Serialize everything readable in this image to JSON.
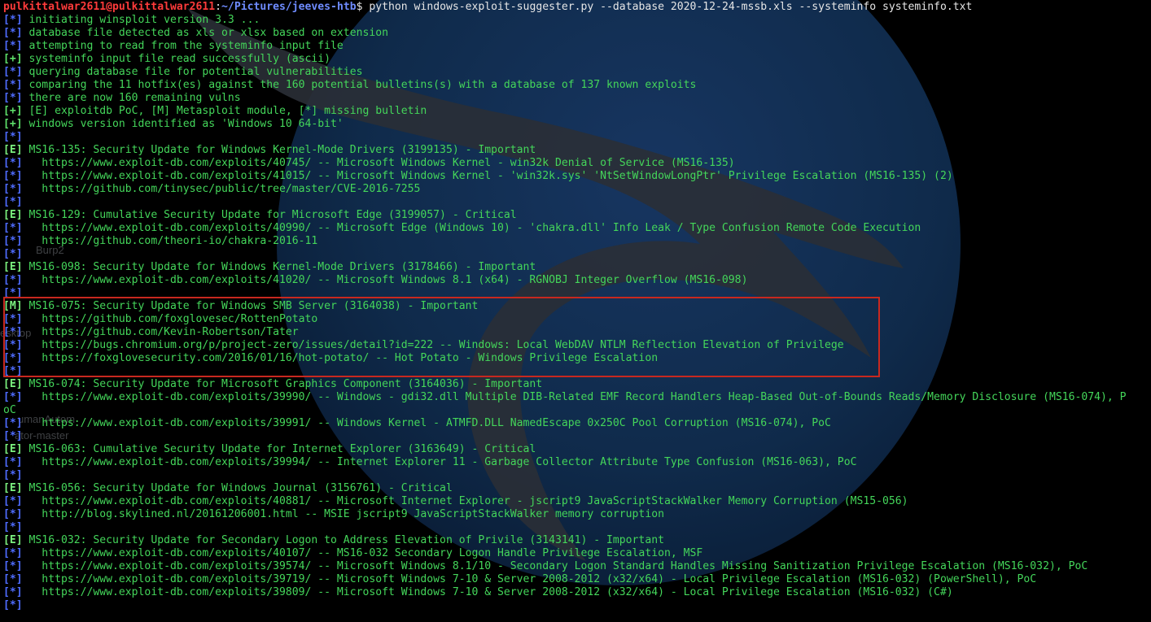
{
  "prompt": {
    "user_host": "pulkittalwar2611@pulkittalwar2611",
    "sep": ":",
    "path": "~/Pictures/jeeves-htb",
    "symbol": "$",
    "command": " python windows-exploit-suggester.py --database 2020-12-24-mssb.xls --systeminfo systeminfo.txt"
  },
  "output": [
    {
      "tag": "[*]",
      "text": " initiating winsploit version 3.3 ..."
    },
    {
      "tag": "[*]",
      "text": " database file detected as xls or xlsx based on extension"
    },
    {
      "tag": "[*]",
      "text": " attempting to read from the systeminfo input file"
    },
    {
      "tag": "[+]",
      "text": " systeminfo input file read successfully (ascii)"
    },
    {
      "tag": "[*]",
      "text": " querying database file for potential vulnerabilities"
    },
    {
      "tag": "[*]",
      "text": " comparing the 11 hotfix(es) against the 160 potential bulletins(s) with a database of 137 known exploits"
    },
    {
      "tag": "[*]",
      "text": " there are now 160 remaining vulns"
    },
    {
      "tag": "[+]",
      "text": " [E] exploitdb PoC, [M] Metasploit module, [*] missing bulletin"
    },
    {
      "tag": "[+]",
      "text": " windows version identified as 'Windows 10 64-bit'"
    },
    {
      "tag": "[*]",
      "text": ""
    },
    {
      "tag": "[E]",
      "text": " MS16-135: Security Update for Windows Kernel-Mode Drivers (3199135) - Important"
    },
    {
      "tag": "[*]",
      "text": "   https://www.exploit-db.com/exploits/40745/ -- Microsoft Windows Kernel - win32k Denial of Service (MS16-135)"
    },
    {
      "tag": "[*]",
      "text": "   https://www.exploit-db.com/exploits/41015/ -- Microsoft Windows Kernel - 'win32k.sys' 'NtSetWindowLongPtr' Privilege Escalation (MS16-135) (2)"
    },
    {
      "tag": "[*]",
      "text": "   https://github.com/tinysec/public/tree/master/CVE-2016-7255"
    },
    {
      "tag": "[*]",
      "text": ""
    },
    {
      "tag": "[E]",
      "text": " MS16-129: Cumulative Security Update for Microsoft Edge (3199057) - Critical"
    },
    {
      "tag": "[*]",
      "text": "   https://www.exploit-db.com/exploits/40990/ -- Microsoft Edge (Windows 10) - 'chakra.dll' Info Leak / Type Confusion Remote Code Execution"
    },
    {
      "tag": "[*]",
      "text": "   https://github.com/theori-io/chakra-2016-11"
    },
    {
      "tag": "[*]",
      "text": ""
    },
    {
      "tag": "[E]",
      "text": " MS16-098: Security Update for Windows Kernel-Mode Drivers (3178466) - Important"
    },
    {
      "tag": "[*]",
      "text": "   https://www.exploit-db.com/exploits/41020/ -- Microsoft Windows 8.1 (x64) - RGNOBJ Integer Overflow (MS16-098)"
    },
    {
      "tag": "[*]",
      "text": ""
    },
    {
      "tag": "[M]",
      "text": " MS16-075: Security Update for Windows SMB Server (3164038) - Important"
    },
    {
      "tag": "[*]",
      "text": "   https://github.com/foxglovesec/RottenPotato"
    },
    {
      "tag": "[*]",
      "text": "   https://github.com/Kevin-Robertson/Tater"
    },
    {
      "tag": "[*]",
      "text": "   https://bugs.chromium.org/p/project-zero/issues/detail?id=222 -- Windows: Local WebDAV NTLM Reflection Elevation of Privilege"
    },
    {
      "tag": "[*]",
      "text": "   https://foxglovesecurity.com/2016/01/16/hot-potato/ -- Hot Potato - Windows Privilege Escalation"
    },
    {
      "tag": "[*]",
      "text": ""
    },
    {
      "tag": "[E]",
      "text": " MS16-074: Security Update for Microsoft Graphics Component (3164036) - Important"
    },
    {
      "tag": "[*]",
      "text": "   https://www.exploit-db.com/exploits/39990/ -- Windows - gdi32.dll Multiple DIB-Related EMF Record Handlers Heap-Based Out-of-Bounds Reads/Memory Disclosure (MS16-074), P"
    },
    {
      "tag": "",
      "text": "oC"
    },
    {
      "tag": "[*]",
      "text": "   https://www.exploit-db.com/exploits/39991/ -- Windows Kernel - ATMFD.DLL NamedEscape 0x250C Pool Corruption (MS16-074), PoC"
    },
    {
      "tag": "[*]",
      "text": ""
    },
    {
      "tag": "[E]",
      "text": " MS16-063: Cumulative Security Update for Internet Explorer (3163649) - Critical"
    },
    {
      "tag": "[*]",
      "text": "   https://www.exploit-db.com/exploits/39994/ -- Internet Explorer 11 - Garbage Collector Attribute Type Confusion (MS16-063), PoC"
    },
    {
      "tag": "[*]",
      "text": ""
    },
    {
      "tag": "[E]",
      "text": " MS16-056: Security Update for Windows Journal (3156761) - Critical"
    },
    {
      "tag": "[*]",
      "text": "   https://www.exploit-db.com/exploits/40881/ -- Microsoft Internet Explorer - jscript9 JavaScriptStackWalker Memory Corruption (MS15-056)"
    },
    {
      "tag": "[*]",
      "text": "   http://blog.skylined.nl/20161206001.html -- MSIE jscript9 JavaScriptStackWalker memory corruption"
    },
    {
      "tag": "[*]",
      "text": ""
    },
    {
      "tag": "[E]",
      "text": " MS16-032: Security Update for Secondary Logon to Address Elevation of Privile (3143141) - Important"
    },
    {
      "tag": "[*]",
      "text": "   https://www.exploit-db.com/exploits/40107/ -- MS16-032 Secondary Logon Handle Privilege Escalation, MSF"
    },
    {
      "tag": "[*]",
      "text": "   https://www.exploit-db.com/exploits/39574/ -- Microsoft Windows 8.1/10 - Secondary Logon Standard Handles Missing Sanitization Privilege Escalation (MS16-032), PoC"
    },
    {
      "tag": "[*]",
      "text": "   https://www.exploit-db.com/exploits/39719/ -- Microsoft Windows 7-10 & Server 2008-2012 (x32/x64) - Local Privilege Escalation (MS16-032) (PowerShell), PoC"
    },
    {
      "tag": "[*]",
      "text": "   https://www.exploit-db.com/exploits/39809/ -- Microsoft Windows 7-10 & Server 2008-2012 (x32/x64) - Local Privilege Escalation (MS16-032) (C#)"
    },
    {
      "tag": "[*]",
      "text": ""
    }
  ],
  "desktop_ghost_labels": [
    {
      "text": "Burp2",
      "name": "desktop-label-burp2"
    },
    {
      "text": "esktop",
      "name": "desktop-label-desktop"
    },
    {
      "text": "umanAutom",
      "name": "desktop-label-humanautom"
    },
    {
      "text": "ator-master",
      "name": "desktop-label-ator-master"
    }
  ],
  "colors": {
    "background": "#000000",
    "output_text": "#44d65a",
    "tag_star": "#4f6cff",
    "tag_plus": "#5ee06a",
    "prompt_user": "#ff3b3b",
    "prompt_path": "#6f8cff",
    "highlight_border": "#c8281f"
  }
}
